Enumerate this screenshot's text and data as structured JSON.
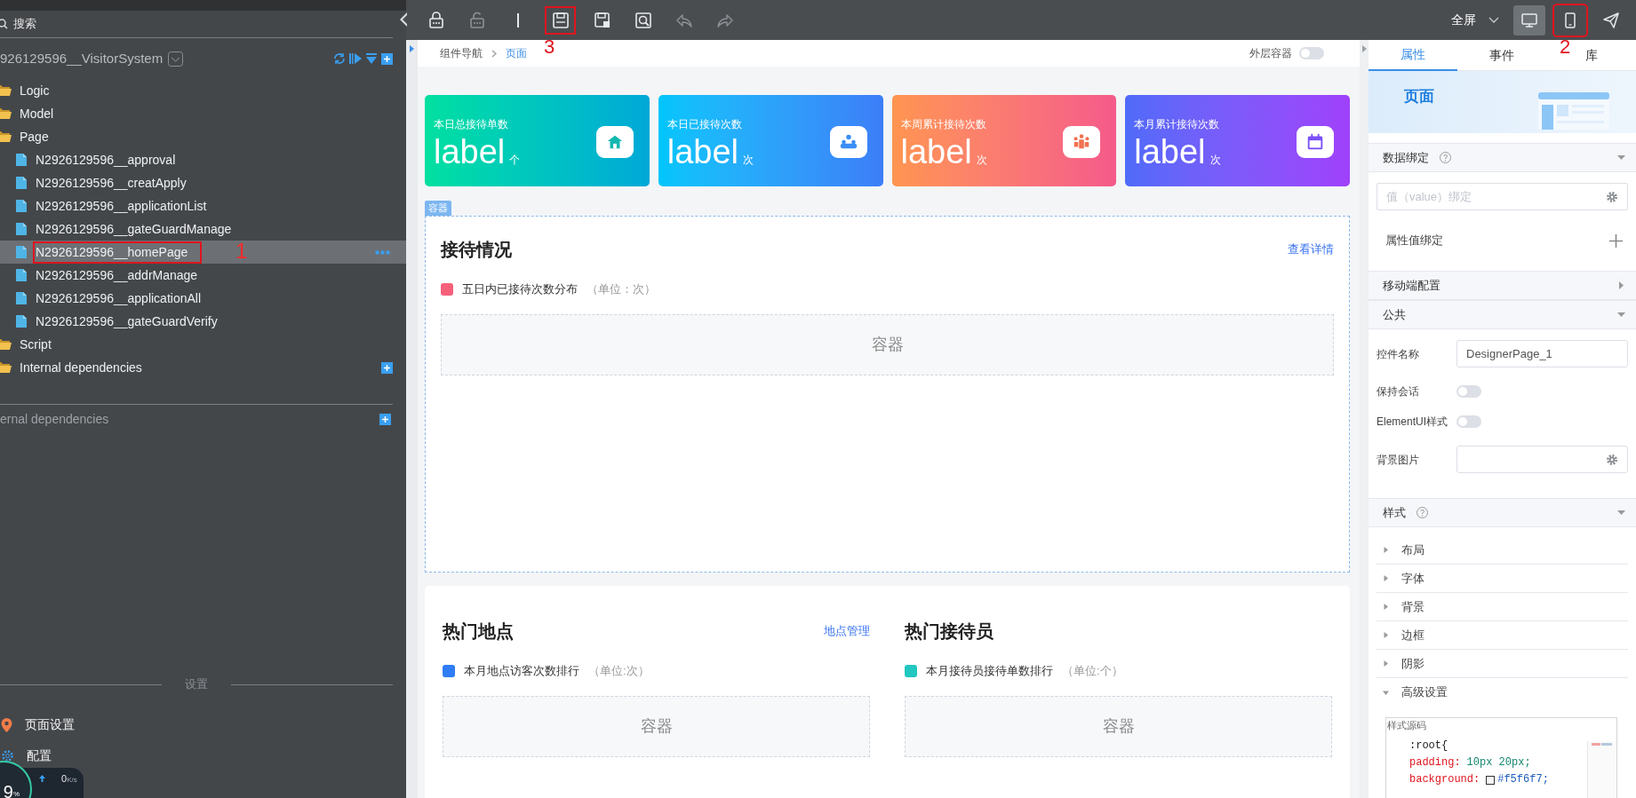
{
  "sidebar": {
    "search_placeholder": "搜索",
    "project": "926129596__VisitorSystem",
    "tree": [
      {
        "label": "Logic",
        "kind": "folder"
      },
      {
        "label": "Model",
        "kind": "folder"
      },
      {
        "label": "Page",
        "kind": "folder",
        "children": [
          {
            "label": "N2926129596__approval",
            "kind": "file",
            "selected": false
          },
          {
            "label": "N2926129596__creatApply",
            "kind": "file",
            "selected": false
          },
          {
            "label": "N2926129596__applicationList",
            "kind": "file",
            "selected": false
          },
          {
            "label": "N2926129596__gateGuardManage",
            "kind": "file",
            "selected": false
          },
          {
            "label": "N2926129596__homePage",
            "kind": "file",
            "selected": true,
            "annotated": true
          },
          {
            "label": "N2926129596__addrManage",
            "kind": "file",
            "selected": false
          },
          {
            "label": "N2926129596__applicationAll",
            "kind": "file",
            "selected": false
          },
          {
            "label": "N2926129596__gateGuardVerify",
            "kind": "file",
            "selected": false
          }
        ]
      },
      {
        "label": "Script",
        "kind": "folder"
      },
      {
        "label": "Internal dependencies",
        "kind": "folder",
        "addable": true
      }
    ],
    "external": "ernal dependencies",
    "settings_title": "设置",
    "settings_items": [
      {
        "label": "页面设置",
        "kind": "pin"
      },
      {
        "label": "配置",
        "kind": "gear"
      }
    ],
    "monitor": {
      "percent": "9",
      "percent_unit": "%",
      "speed": "0",
      "speed_unit": "K/s"
    }
  },
  "toolbar": {
    "tools": [
      {
        "kind": "lock",
        "disabled": false
      },
      {
        "kind": "unlock",
        "disabled": true
      },
      {
        "kind": "cursor",
        "disabled": false
      },
      {
        "kind": "save",
        "disabled": false,
        "annotated": true
      },
      {
        "kind": "save-as",
        "disabled": false
      },
      {
        "kind": "preview",
        "disabled": false
      },
      {
        "kind": "undo",
        "disabled": true
      },
      {
        "kind": "redo",
        "disabled": true
      }
    ],
    "view_mode": "全屏",
    "devices": [
      {
        "kind": "desktop",
        "selected": true,
        "annotated": false
      },
      {
        "kind": "mobile",
        "selected": false,
        "annotated": true
      }
    ]
  },
  "annotations": [
    {
      "label": "1"
    },
    {
      "label": "2"
    },
    {
      "label": "3"
    }
  ],
  "canvas": {
    "breadcrumb": [
      "组件导航",
      "页面"
    ],
    "outer_container": {
      "label": "外层容器",
      "on": false
    },
    "cards": [
      {
        "title": "本日总接待单数",
        "value": "label",
        "unit": "个",
        "kind": "home"
      },
      {
        "title": "本日已接待次数",
        "value": "label",
        "unit": "次",
        "kind": "team"
      },
      {
        "title": "本周累计接待次数",
        "value": "label",
        "unit": "次",
        "kind": "people"
      },
      {
        "title": "本月累计接待次数",
        "value": "label",
        "unit": "次",
        "kind": "calendar"
      }
    ],
    "container_tag": "容器",
    "reception": {
      "title": "接待情况",
      "link": "查看详情",
      "legend": "五日内已接待次数分布",
      "unit": "（单位：次）",
      "placeholder": "容器",
      "color": "#f5607a"
    },
    "hot": [
      {
        "title": "热门地点",
        "link": "地点管理",
        "legend": "本月地点访客次数排行",
        "unit": "（单位:次）",
        "placeholder": "容器",
        "color": "#2f7cf6"
      },
      {
        "title": "热门接待员",
        "legend": "本月接待员接待单数排行",
        "unit": "（单位:个）",
        "placeholder": "容器",
        "color": "#22c7c0"
      }
    ]
  },
  "panel": {
    "tabs": [
      {
        "label": "属性",
        "selected": true
      },
      {
        "label": "事件",
        "selected": false
      },
      {
        "label": "库",
        "selected": false
      }
    ],
    "banner_title": "页面",
    "data_binding": {
      "title": "数据绑定",
      "expanded": true,
      "placeholder": "值（value）绑定",
      "attr_binding": "属性值绑定"
    },
    "mobile_config": {
      "title": "移动端配置",
      "expanded": false
    },
    "common": {
      "title": "公共",
      "expanded": true,
      "fields": [
        {
          "kind": "text",
          "label": "控件名称",
          "value": "DesignerPage_1"
        },
        {
          "kind": "toggle",
          "label": "保持会话",
          "on": false
        },
        {
          "kind": "toggle",
          "label": "ElementUI样式",
          "on": false
        },
        {
          "kind": "picker",
          "label": "背景图片"
        }
      ]
    },
    "style": {
      "title": "样式",
      "expanded": true,
      "groups": [
        {
          "label": "布局",
          "expanded": false
        },
        {
          "label": "字体",
          "expanded": false
        },
        {
          "label": "背景",
          "expanded": false
        },
        {
          "label": "边框",
          "expanded": false
        },
        {
          "label": "阴影",
          "expanded": false
        },
        {
          "label": "高级设置",
          "expanded": true
        }
      ],
      "source": {
        "title": "样式源码",
        "lines": [
          {
            "kind": "selector",
            "text": ":root{"
          },
          {
            "kind": "decl",
            "prop": "padding:",
            "value": "10px 20px;"
          },
          {
            "kind": "decl",
            "prop": "background:",
            "value": "#f5f6f7;",
            "swatch": true
          }
        ]
      }
    }
  }
}
